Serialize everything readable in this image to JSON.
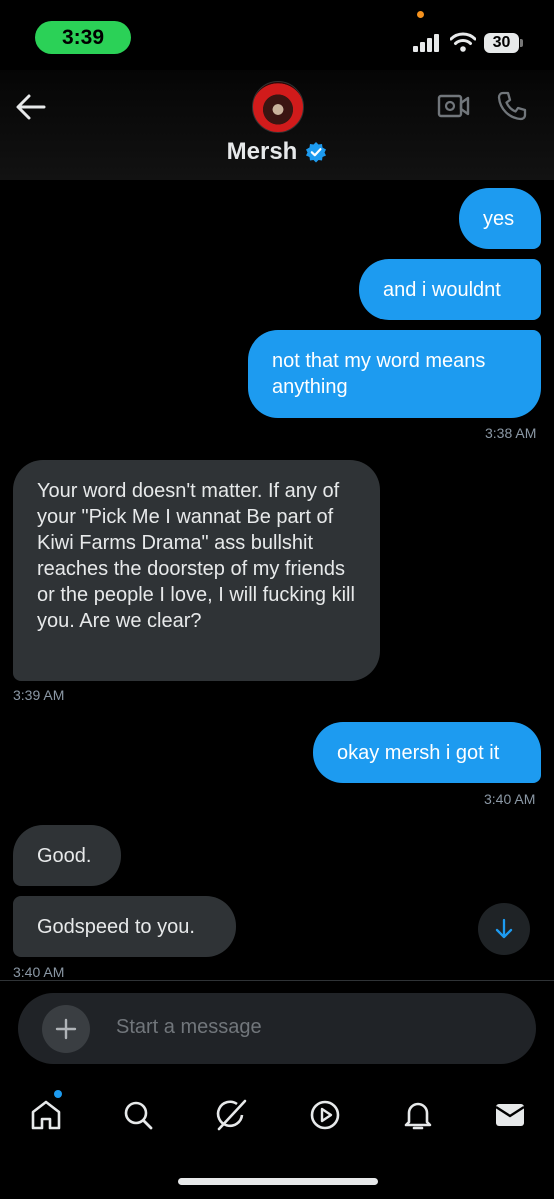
{
  "status_bar": {
    "time": "3:39",
    "battery": "30"
  },
  "header": {
    "contact_name": "Mersh",
    "icons": [
      "back-arrow-icon",
      "video-call-icon",
      "phone-call-icon",
      "verified-badge-icon"
    ]
  },
  "messages": [
    {
      "direction": "outgoing",
      "text": "yes"
    },
    {
      "direction": "outgoing",
      "text": "and i wouldnt"
    },
    {
      "direction": "outgoing",
      "text": "not that my word means anything",
      "time": "3:38 AM"
    },
    {
      "direction": "incoming",
      "text": "Your word doesn't matter. If any of your \"Pick Me I wannat Be part of Kiwi Farms Drama\" ass bullshit reaches the doorstep of my friends or the people I love, I will fucking kill you. Are we clear?",
      "time": "3:39 AM"
    },
    {
      "direction": "outgoing",
      "text": "okay mersh i got it",
      "time": "3:40 AM"
    },
    {
      "direction": "incoming",
      "text": "Good."
    },
    {
      "direction": "incoming",
      "text": "Godspeed to you.",
      "time": "3:40 AM"
    }
  ],
  "composer": {
    "placeholder": "Start a message"
  },
  "tab_bar": {
    "items": [
      "home-icon",
      "search-icon",
      "grok-icon",
      "video-icon",
      "notifications-icon",
      "messages-icon"
    ]
  },
  "colors": {
    "outgoing_bubble": "#1d9bf0",
    "incoming_bubble": "#2f3336",
    "accent": "#1d9bf0",
    "time_pill": "#2bd157"
  }
}
